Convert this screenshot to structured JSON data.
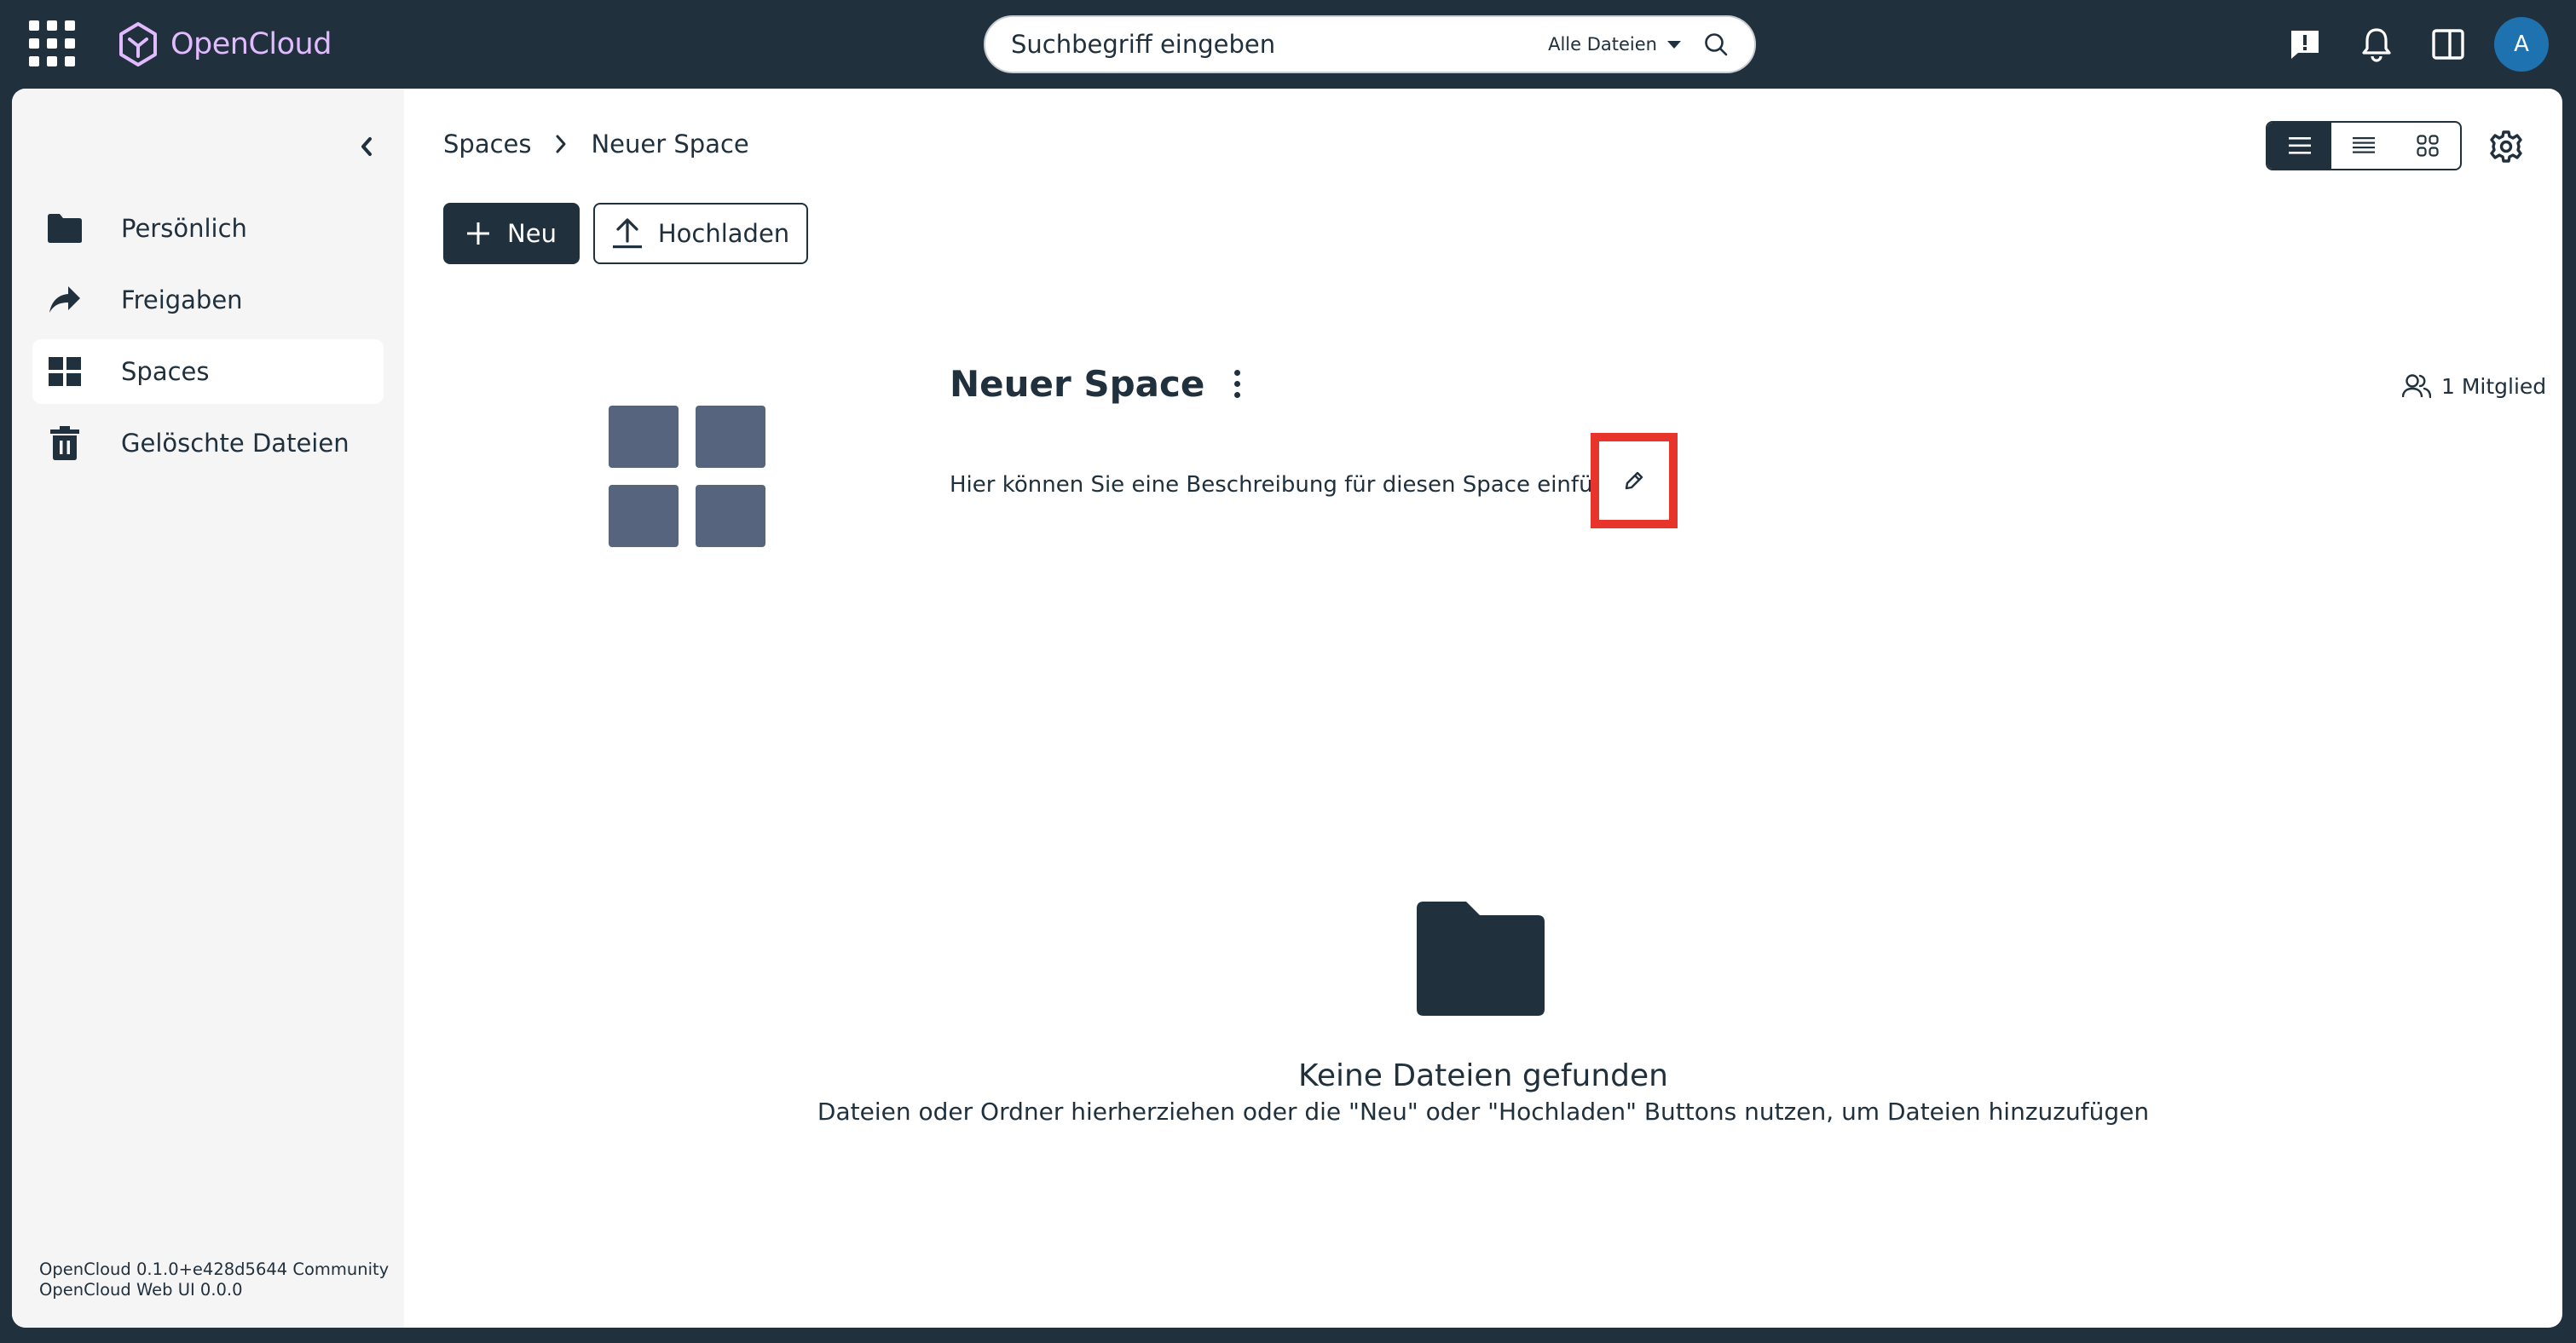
{
  "header": {
    "brand": "OpenCloud",
    "search": {
      "placeholder": "Suchbegriff eingeben",
      "scope": "Alle Dateien"
    },
    "avatar_initial": "A",
    "icons": [
      "apps-icon",
      "feedback-icon",
      "bell-icon",
      "sidebar-toggle-icon"
    ]
  },
  "sidebar": {
    "items": [
      {
        "label": "Persönlich",
        "icon": "folder-icon",
        "active": false
      },
      {
        "label": "Freigaben",
        "icon": "share-icon",
        "active": false
      },
      {
        "label": "Spaces",
        "icon": "grid-icon",
        "active": true
      },
      {
        "label": "Gelöschte Dateien",
        "icon": "trash-icon",
        "active": false
      }
    ],
    "version_line1": "OpenCloud 0.1.0+e428d5644 Community",
    "version_line2": "OpenCloud Web UI 0.0.0"
  },
  "breadcrumb": {
    "items": [
      "Spaces",
      "Neuer Space"
    ]
  },
  "toolbar": {
    "new_label": "Neu",
    "upload_label": "Hochladen"
  },
  "space": {
    "title": "Neuer Space",
    "members": "1 Mitglied",
    "description": "Hier können Sie eine Beschreibung für diesen Space einfügen"
  },
  "empty": {
    "title": "Keine Dateien gefunden",
    "description": "Dateien oder Ordner hierherziehen oder die \"Neu\" oder \"Hochladen\" Buttons nutzen, um Dateien hinzuzufügen"
  },
  "colors": {
    "primary": "#20303c",
    "brand_accent": "#e2baff",
    "avatar": "#1f72b0",
    "highlight": "#e8352b",
    "tile": "#56647d"
  }
}
